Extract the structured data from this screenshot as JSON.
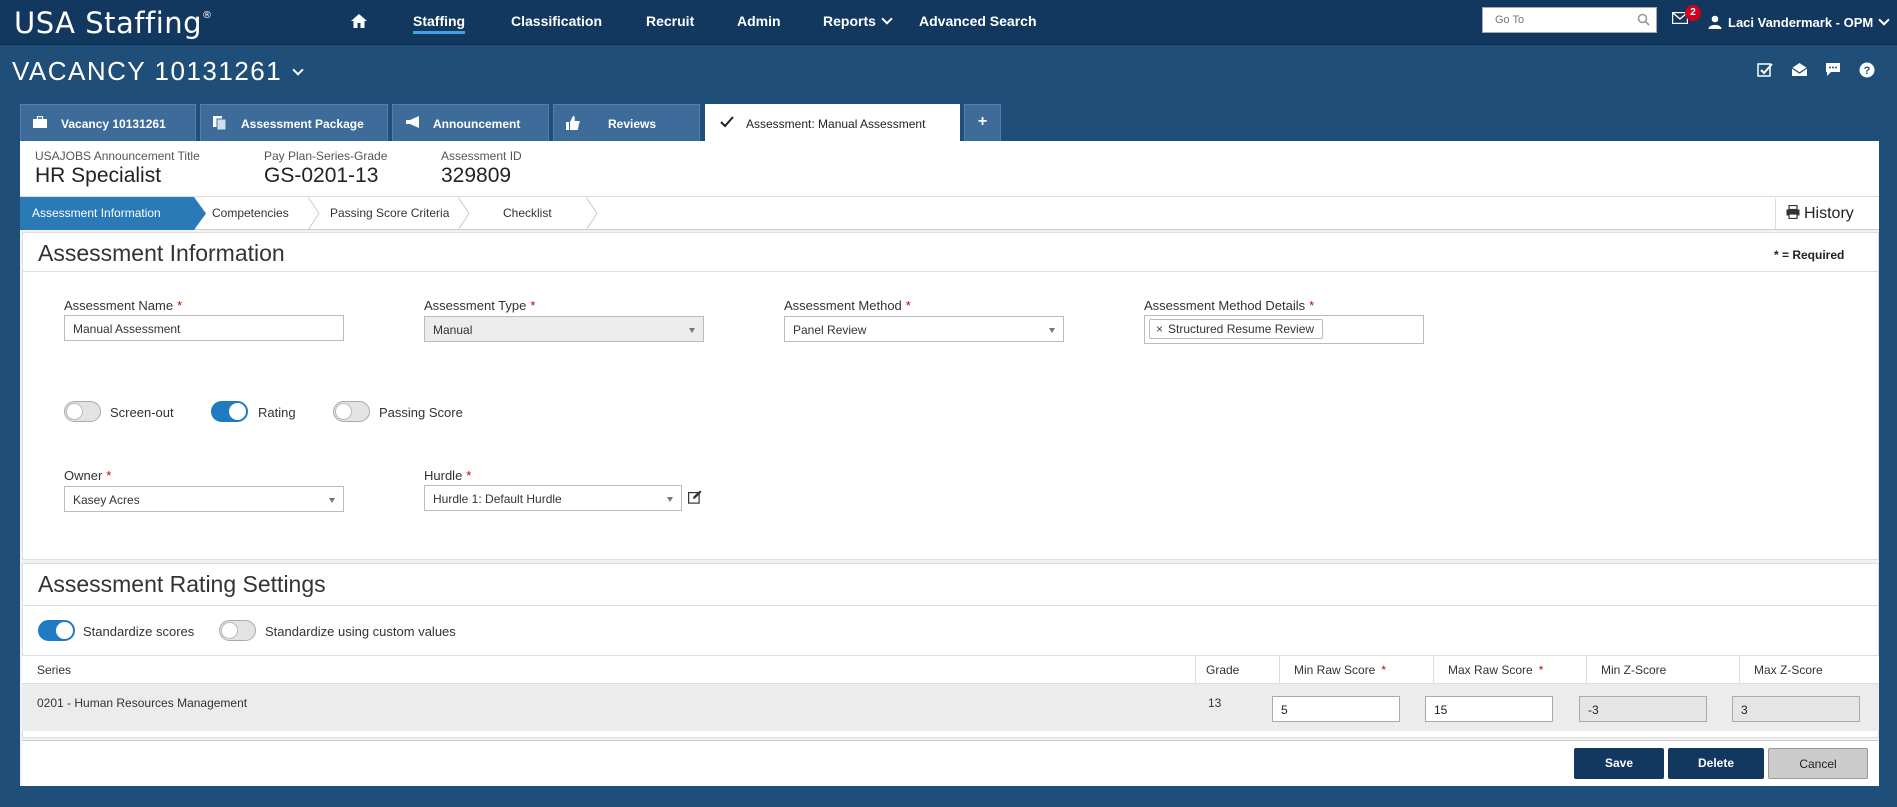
{
  "app": {
    "logo": "USA Staffing",
    "logo_mark": "®",
    "nav": [
      "Staffing",
      "Classification",
      "Recruit",
      "Admin",
      "Reports",
      "Advanced Search"
    ],
    "goto_placeholder": "Go To",
    "mail_count": "2",
    "user_name": "Laci Vandermark - OPM"
  },
  "vacancy": {
    "title": "VACANCY 10131261"
  },
  "tabs": [
    {
      "label": "Vacancy 10131261"
    },
    {
      "label": "Assessment Package"
    },
    {
      "label": "Announcement"
    },
    {
      "label": "Reviews"
    },
    {
      "label": "Assessment: Manual Assessment"
    },
    {
      "label": "+"
    }
  ],
  "info": {
    "announcement_title_label": "USAJOBS Announcement Title",
    "announcement_title": "HR Specialist",
    "ppsg_label": "Pay Plan-Series-Grade",
    "ppsg": "GS-0201-13",
    "assessment_id_label": "Assessment ID",
    "assessment_id": "329809"
  },
  "steps": [
    "Assessment Information",
    "Competencies",
    "Passing Score Criteria",
    "Checklist"
  ],
  "history_label": "History",
  "assessment_info": {
    "title": "Assessment Information",
    "required_note": "* = Required",
    "name_label": "Assessment Name",
    "name_value": "Manual Assessment",
    "type_label": "Assessment Type",
    "type_value": "Manual",
    "method_label": "Assessment Method",
    "method_value": "Panel Review",
    "method_details_label": "Assessment Method Details",
    "method_details_chip": "Structured Resume Review",
    "toggles": [
      {
        "label": "Screen-out",
        "on": false
      },
      {
        "label": "Rating",
        "on": true
      },
      {
        "label": "Passing Score",
        "on": false
      }
    ],
    "owner_label": "Owner",
    "owner_value": "Kasey Acres",
    "hurdle_label": "Hurdle",
    "hurdle_value": "Hurdle 1: Default Hurdle",
    "required_star": "*"
  },
  "rating_settings": {
    "title": "Assessment Rating Settings",
    "standardize_label": "Standardize scores",
    "standardize_on": true,
    "custom_label": "Standardize using custom values",
    "custom_on": false,
    "columns": [
      "Series",
      "Grade",
      "Min Raw Score",
      "Max Raw Score",
      "Min Z-Score",
      "Max Z-Score"
    ],
    "rows": [
      {
        "series": "0201 - Human Resources Management",
        "grade": "13",
        "min_raw": "5",
        "max_raw": "15",
        "min_z": "-3",
        "max_z": "3"
      }
    ]
  },
  "buttons": {
    "save": "Save",
    "delete": "Delete",
    "cancel": "Cancel"
  },
  "colors": {
    "nav_bg": "#12385f",
    "page_bg": "#1f4e79",
    "accent": "#1f7bc1",
    "required": "#cc0000"
  }
}
